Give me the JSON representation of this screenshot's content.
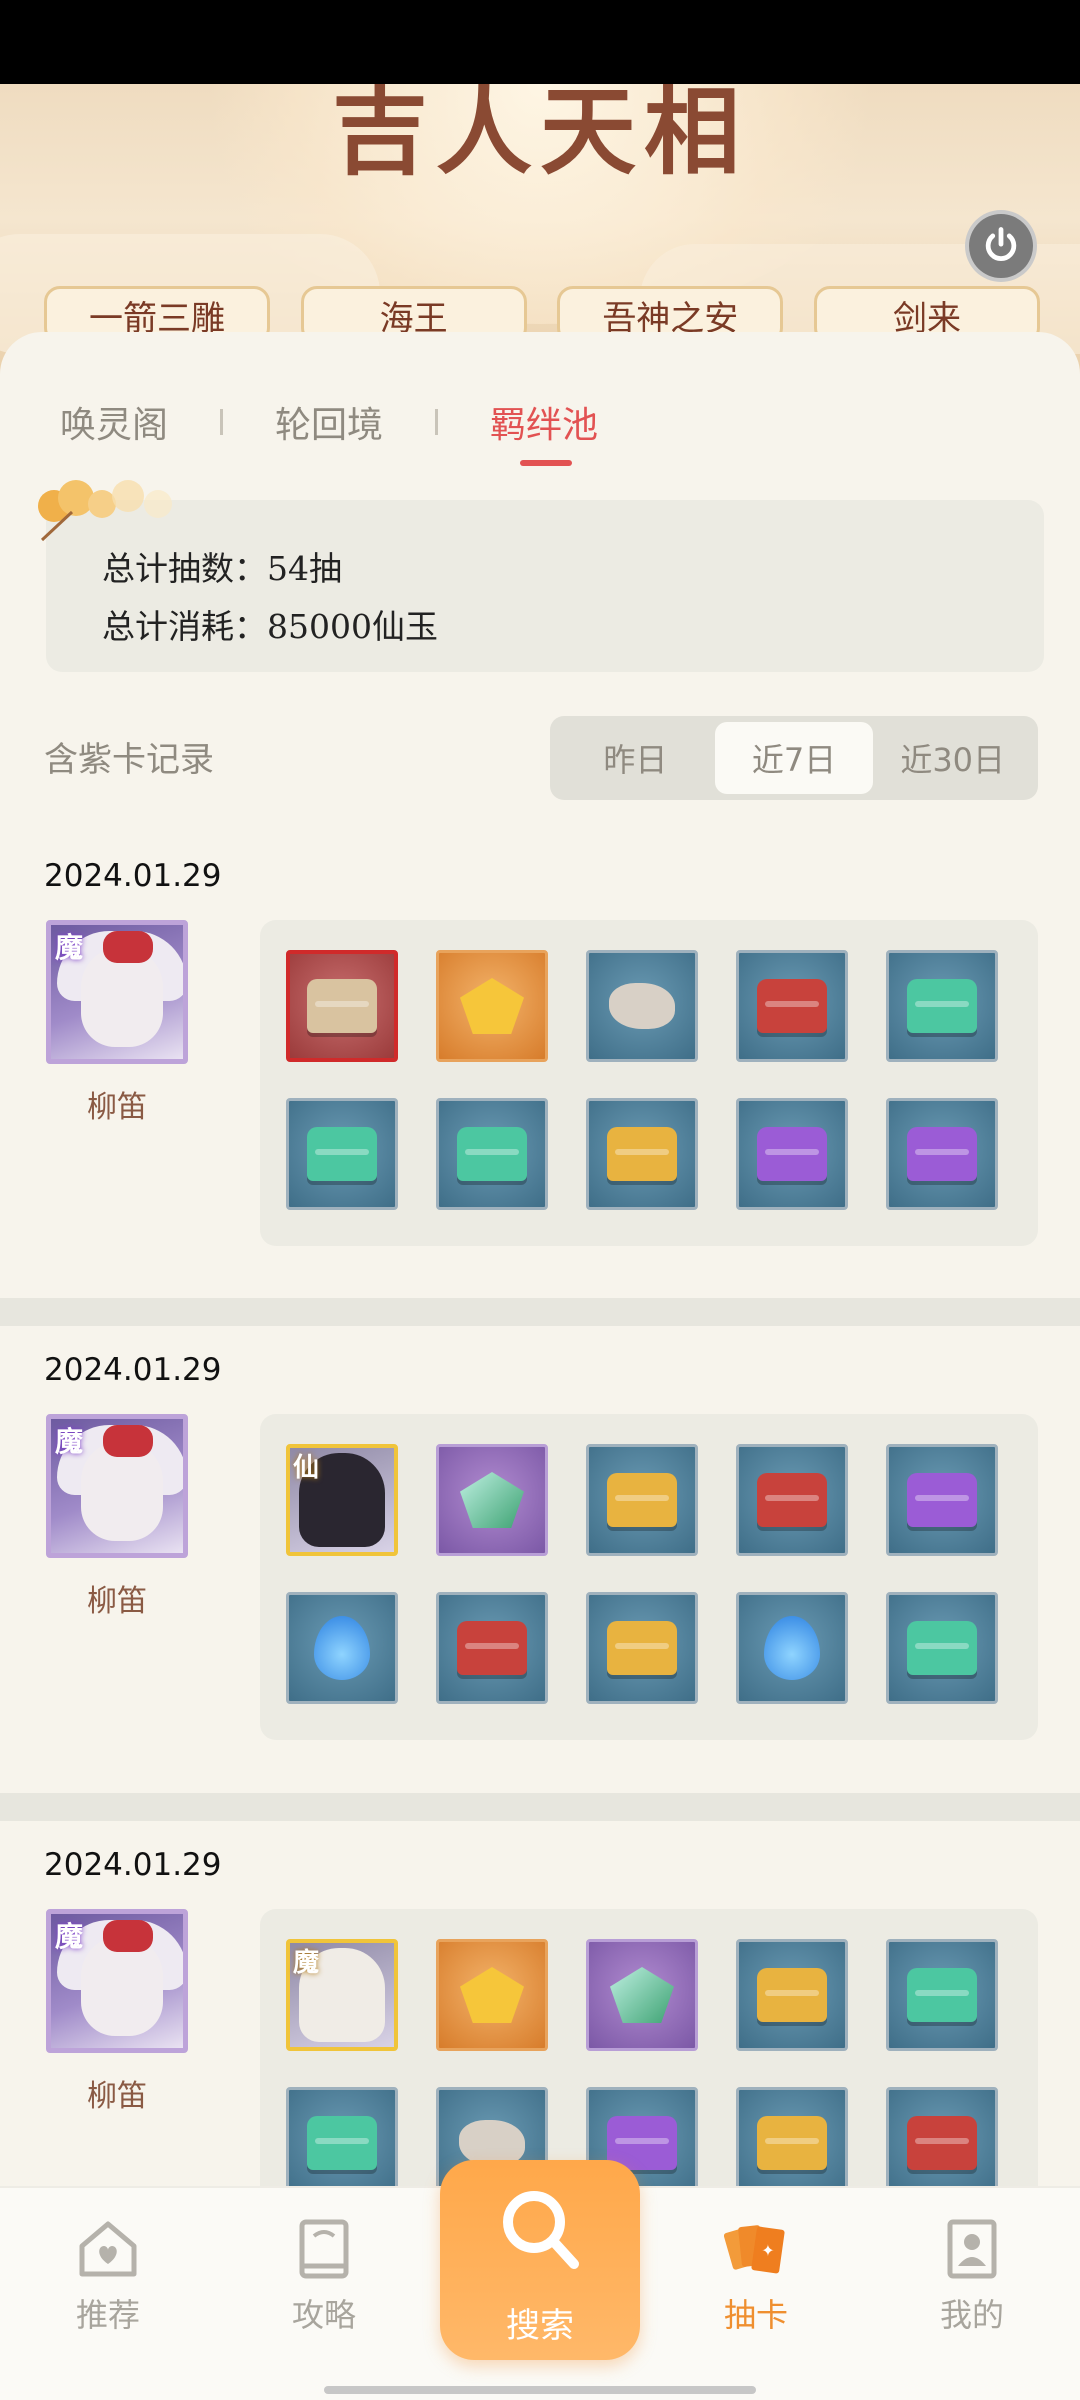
{
  "hero": {
    "title": "吉人天相",
    "chips": [
      "一箭三雕",
      "海王",
      "吾神之安",
      "剑来"
    ]
  },
  "tabs": [
    {
      "label": "唤灵阁",
      "active": false
    },
    {
      "label": "轮回境",
      "active": false
    },
    {
      "label": "羁绊池",
      "active": true
    }
  ],
  "stats": {
    "total_draws_label": "总计抽数：",
    "total_draws_value": "54抽",
    "total_cost_label": "总计消耗：",
    "total_cost_value": "85000仙玉"
  },
  "records": {
    "heading": "含紫卡记录",
    "ranges": [
      {
        "label": "昨日",
        "active": false
      },
      {
        "label": "近7日",
        "active": true
      },
      {
        "label": "近30日",
        "active": false
      }
    ],
    "items": [
      {
        "date": "2024.01.29",
        "character": {
          "name": "柳笛",
          "badge": "魔"
        },
        "slots": [
          {
            "kind": "treasure-box",
            "frame": "red"
          },
          {
            "kind": "gold-nugget",
            "frame": "orange"
          },
          {
            "kind": "stone",
            "frame": "blue"
          },
          {
            "kind": "red-chest",
            "frame": "blue"
          },
          {
            "kind": "green-chest",
            "frame": "blue"
          },
          {
            "kind": "green-chest",
            "frame": "blue"
          },
          {
            "kind": "green-chest",
            "frame": "blue"
          },
          {
            "kind": "gold-chest",
            "frame": "blue"
          },
          {
            "kind": "purple-chest",
            "frame": "blue"
          },
          {
            "kind": "purple-chest",
            "frame": "blue"
          }
        ]
      },
      {
        "date": "2024.01.29",
        "character": {
          "name": "柳笛",
          "badge": "魔"
        },
        "slots": [
          {
            "kind": "character-portrait",
            "frame": "gold",
            "badge": "仙"
          },
          {
            "kind": "jade-crystal",
            "frame": "purple"
          },
          {
            "kind": "gold-chest",
            "frame": "blue"
          },
          {
            "kind": "red-chest",
            "frame": "blue"
          },
          {
            "kind": "purple-chest",
            "frame": "blue"
          },
          {
            "kind": "blue-flame",
            "frame": "blue"
          },
          {
            "kind": "red-chest",
            "frame": "blue"
          },
          {
            "kind": "gold-chest",
            "frame": "blue"
          },
          {
            "kind": "blue-flame",
            "frame": "blue"
          },
          {
            "kind": "green-chest",
            "frame": "blue"
          }
        ]
      },
      {
        "date": "2024.01.29",
        "character": {
          "name": "柳笛",
          "badge": "魔"
        },
        "slots": [
          {
            "kind": "character-portrait",
            "frame": "gold",
            "badge": "魔"
          },
          {
            "kind": "gold-nugget",
            "frame": "orange"
          },
          {
            "kind": "jade-crystal",
            "frame": "purple"
          },
          {
            "kind": "gold-chest",
            "frame": "blue"
          },
          {
            "kind": "green-chest",
            "frame": "blue"
          },
          {
            "kind": "green-chest",
            "frame": "blue"
          },
          {
            "kind": "stone",
            "frame": "blue"
          },
          {
            "kind": "purple-chest",
            "frame": "blue"
          },
          {
            "kind": "gold-chest",
            "frame": "blue"
          },
          {
            "kind": "red-chest",
            "frame": "blue"
          }
        ]
      }
    ]
  },
  "nav": {
    "items": [
      {
        "label": "推荐",
        "icon": "home-heart-icon",
        "active": false
      },
      {
        "label": "攻略",
        "icon": "guide-book-icon",
        "active": false
      },
      {
        "label": "搜索",
        "icon": "search-icon",
        "active": false
      },
      {
        "label": "抽卡",
        "icon": "cards-icon",
        "active": true
      },
      {
        "label": "我的",
        "icon": "profile-icon",
        "active": false
      }
    ]
  },
  "colors": {
    "accent": "#e25252",
    "nav_active": "#ef8f2f",
    "fab": "#ffa84a"
  }
}
